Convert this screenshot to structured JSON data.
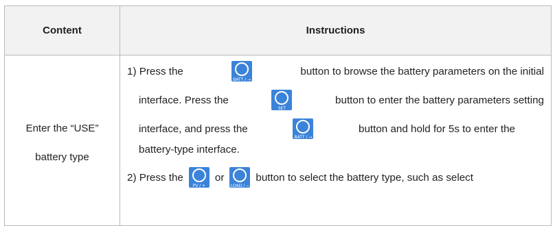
{
  "table": {
    "header": {
      "content": "Content",
      "instructions": "Instructions"
    },
    "row": {
      "content_line1": "Enter the “USE”",
      "content_line2": "battery type",
      "step1": {
        "a": "1) Press the",
        "b": "button to browse the battery parameters on the initial",
        "c": "interface. Press the",
        "d": "button to enter the battery parameters setting",
        "e": "interface, and press the",
        "f": "button and hold for 5s to enter the",
        "g": "battery-type interface."
      },
      "step2": {
        "a": "2) Press the",
        "or": "or",
        "b": "button to select the battery type, such as select"
      }
    }
  },
  "buttons": {
    "batt": {
      "label": "BATT / →",
      "icon": "batt-button-icon"
    },
    "set": {
      "label": "SET",
      "icon": "set-button-icon"
    },
    "pv": {
      "label": "PV / +",
      "icon": "pv-plus-button-icon"
    },
    "load": {
      "label": "LOAD / −",
      "icon": "load-minus-button-icon"
    },
    "color": "#3b83d9"
  }
}
